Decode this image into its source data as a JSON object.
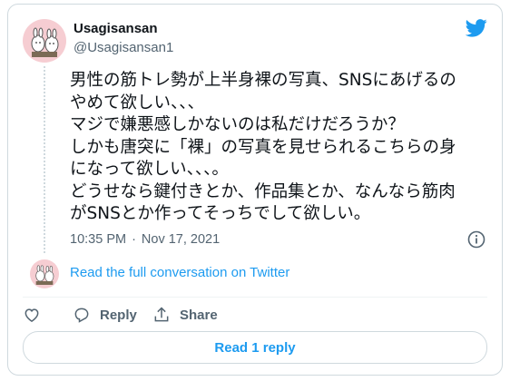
{
  "tweet": {
    "display_name": "Usagisansan",
    "handle": "@Usagisansan1",
    "text": "男性の筋トレ勢が上半身裸の写真、SNSにあげるの\nやめて欲しい、、、\nマジで嫌悪感しかないのは私だけだろうか？\nしかも唐突に「裸」の写真を見せられるこちらの身\nになって欲しい、、、。\nどうせなら鍵付きとか、作品集とか、なんなら筋肉\nがSNSとか作ってそっちでして欲しい。",
    "time": "10:35 PM",
    "date": "Nov 17, 2021",
    "separator": "·"
  },
  "conversation": {
    "link_text": "Read the full conversation on Twitter"
  },
  "actions": {
    "reply_label": "Reply",
    "share_label": "Share"
  },
  "read_replies": {
    "label": "Read 1 reply"
  },
  "colors": {
    "accent": "#1d9bf0",
    "secondary_text": "#536471",
    "avatar_bg": "#f6cdd2",
    "border": "#cfd9de"
  },
  "icons": [
    "avatar-illustration",
    "twitter-bird-icon",
    "info-icon",
    "heart-icon",
    "reply-icon",
    "share-icon"
  ]
}
